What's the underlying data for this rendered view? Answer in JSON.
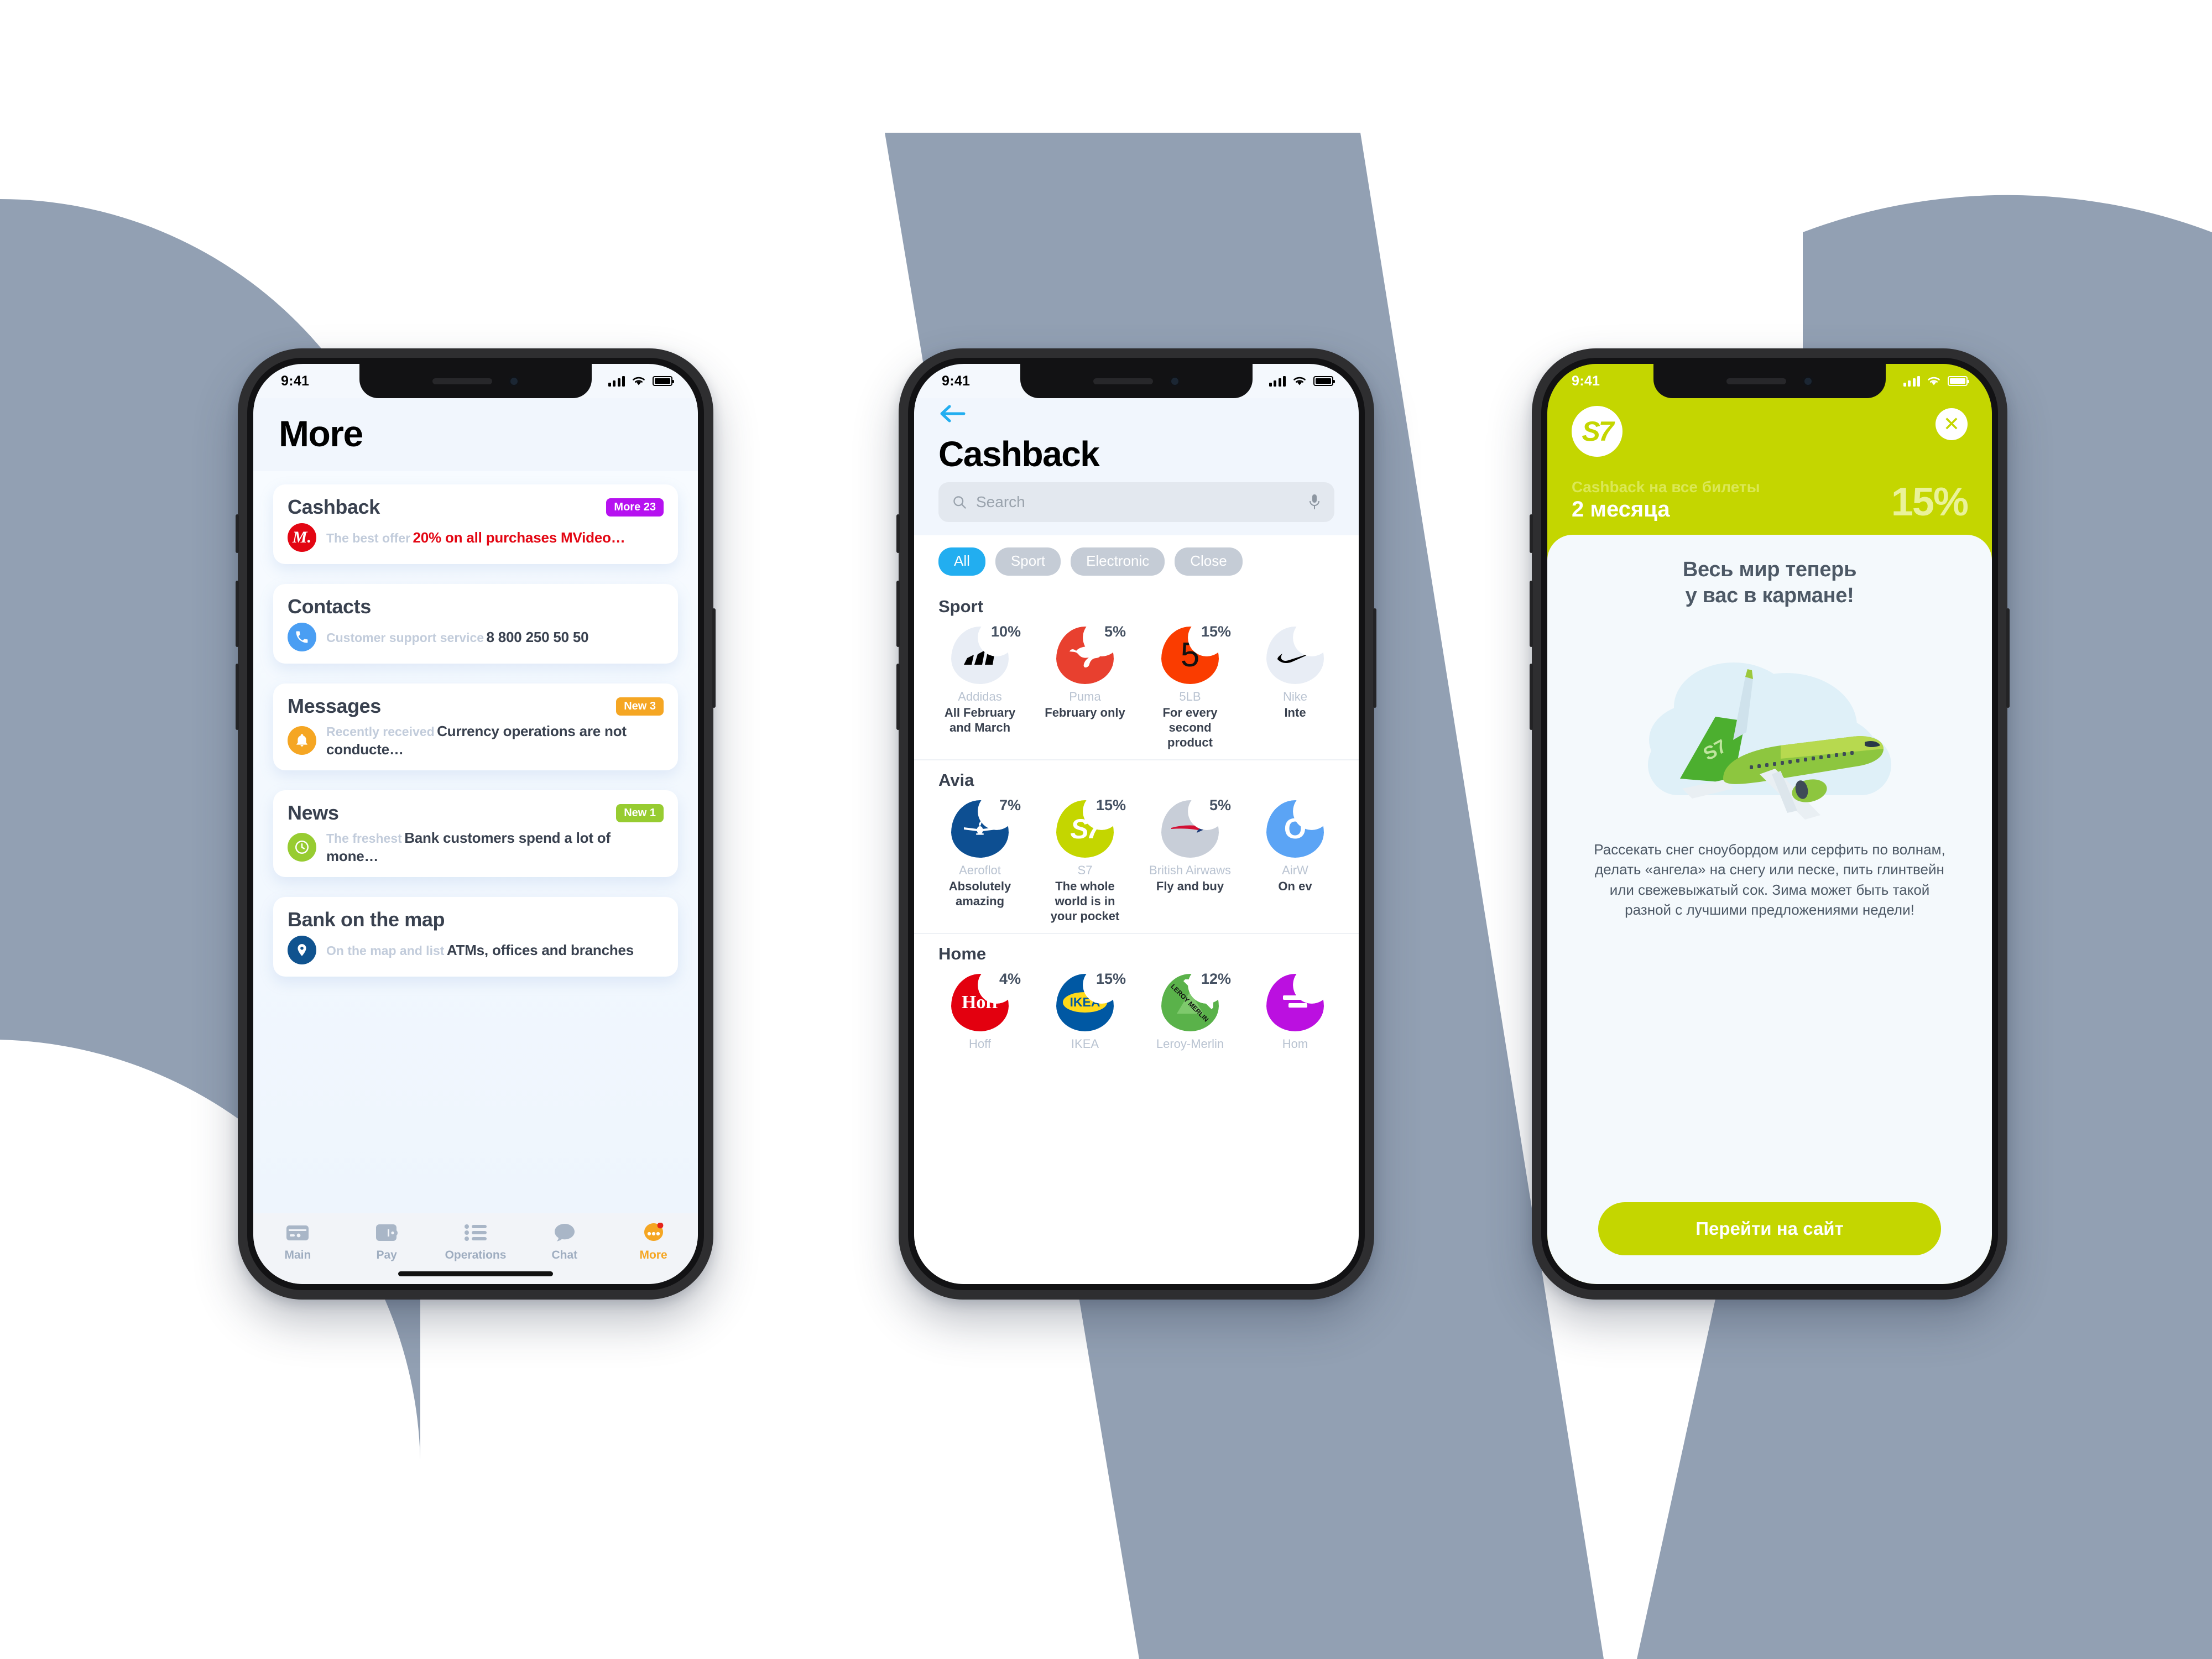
{
  "background": {
    "shape_color": "#92a0b3"
  },
  "phone1": {
    "status": {
      "time": "9:41"
    },
    "title": "More",
    "cards": [
      {
        "title": "Cashback",
        "badge": "More 23",
        "badge_color": "#b611f0",
        "logo": "mvideo-logo",
        "logo_color": "#e30613",
        "sub": "The best offer",
        "main": "20% on all purchases MVideo…",
        "main_is_red": true
      },
      {
        "title": "Contacts",
        "badge": "",
        "badge_color": "",
        "logo": "phone-icon",
        "logo_color": "#4a9ef3",
        "sub": "Customer support  service",
        "main": "8 800 250 50 50",
        "main_is_red": false
      },
      {
        "title": "Messages",
        "badge": "New 3",
        "badge_color": "#f5a623",
        "logo": "bell-icon",
        "logo_color": "#f5a623",
        "sub": "Recently received",
        "main": "Currency operations are not conducte…",
        "main_is_red": false
      },
      {
        "title": "News",
        "badge": "New 1",
        "badge_color": "#97cc31",
        "logo": "clock-icon",
        "logo_color": "#97cc31",
        "sub": "The freshest",
        "main": "Bank customers spend a lot of mone…",
        "main_is_red": false
      },
      {
        "title": "Bank on the map",
        "badge": "",
        "badge_color": "",
        "logo": "map-pin-icon",
        "logo_color": "#10538f",
        "sub": "On the map and list",
        "main": "ATMs, offices and branches",
        "main_is_red": false
      }
    ],
    "tabs": [
      {
        "label": "Main",
        "icon": "card-icon",
        "active": false
      },
      {
        "label": "Pay",
        "icon": "wallet-icon",
        "active": false
      },
      {
        "label": "Operations",
        "icon": "list-icon",
        "active": false
      },
      {
        "label": "Chat",
        "icon": "chat-bubble-icon",
        "active": false
      },
      {
        "label": "More",
        "icon": "more-dots-icon",
        "active": true
      }
    ],
    "accent": "#f5a623"
  },
  "phone2": {
    "status": {
      "time": "9:41"
    },
    "back_icon": "arrow-left-icon",
    "title": "Cashback",
    "search": {
      "placeholder": "Search",
      "value": "",
      "icon": "search-icon",
      "mic": "microphone-icon"
    },
    "chips": [
      {
        "label": "All",
        "selected": true
      },
      {
        "label": "Sport",
        "selected": false
      },
      {
        "label": "Electronic",
        "selected": false
      },
      {
        "label": "Close",
        "selected": false
      }
    ],
    "chip_active_color": "#22aef0",
    "sections": [
      {
        "title": "Sport",
        "tiles": [
          {
            "name": "Addidas",
            "pct": "10%",
            "desc": "All February and March",
            "logo": "adidas-logo",
            "bg": "#e8edf5",
            "fg": "#000000"
          },
          {
            "name": "Puma",
            "pct": "5%",
            "desc": "February only",
            "logo": "puma-logo",
            "bg": "#e8402f",
            "fg": "#ffffff"
          },
          {
            "name": "5LB",
            "pct": "15%",
            "desc": "For every second product",
            "logo": "5lb-logo",
            "bg": "#fa3c00",
            "fg": "#000000"
          },
          {
            "name": "Nike",
            "pct": "",
            "desc": "Inte",
            "logo": "nike-logo",
            "bg": "#e8edf5",
            "fg": "#000000"
          }
        ]
      },
      {
        "title": "Avia",
        "tiles": [
          {
            "name": "Aeroflot",
            "pct": "7%",
            "desc": "Absolutely amazing",
            "logo": "aeroflot-logo",
            "bg": "#0d4f92",
            "fg": "#ffffff"
          },
          {
            "name": "S7",
            "pct": "15%",
            "desc": "The whole world is in your pocket",
            "logo": "s7-logo",
            "bg": "#c4d600",
            "fg": "#ffffff"
          },
          {
            "name": "British Airwaws",
            "pct": "5%",
            "desc": "Fly and buy",
            "logo": "british-airways-logo",
            "bg": "#c8ced8",
            "fg": "#d21034"
          },
          {
            "name": "AirW",
            "pct": "",
            "desc": "On ev",
            "logo": "airways-logo",
            "bg": "#5ba4f5",
            "fg": "#ffffff"
          }
        ]
      },
      {
        "title": "Home",
        "tiles": [
          {
            "name": "Hoff",
            "pct": "4%",
            "desc": "",
            "logo": "hoff-logo",
            "bg": "#e3000f",
            "fg": "#ffffff"
          },
          {
            "name": "IKEA",
            "pct": "15%",
            "desc": "",
            "logo": "ikea-logo",
            "bg": "#0058a3",
            "fg": "#ffda1a"
          },
          {
            "name": "Leroy-Merlin",
            "pct": "12%",
            "desc": "",
            "logo": "leroy-merlin-logo",
            "bg": "#5ab24a",
            "fg": "#ffffff"
          },
          {
            "name": "Hom",
            "pct": "",
            "desc": "",
            "logo": "home-logo",
            "bg": "#bb10e0",
            "fg": "#ffffff"
          }
        ]
      }
    ]
  },
  "phone3": {
    "status": {
      "time": "9:41"
    },
    "brand_mark": "S7",
    "close_icon": "close-icon",
    "banner_color": "#c4d600",
    "banner": {
      "eyebrow": "Cashback на все билеты",
      "duration": "2 месяца",
      "percent": "15%"
    },
    "headline": "Весь мир теперь\nу вас в кармане!",
    "illustration": "s7-airplane-illustration",
    "body": "Рассекать снег сноубордом или серфить по волнам, делать «ангела» на снегу или песке, пить глинтвейн или свежевыжатый сок. Зима может быть такой разной с лучшими предложениями недели!",
    "cta_label": "Перейти на сайт"
  }
}
